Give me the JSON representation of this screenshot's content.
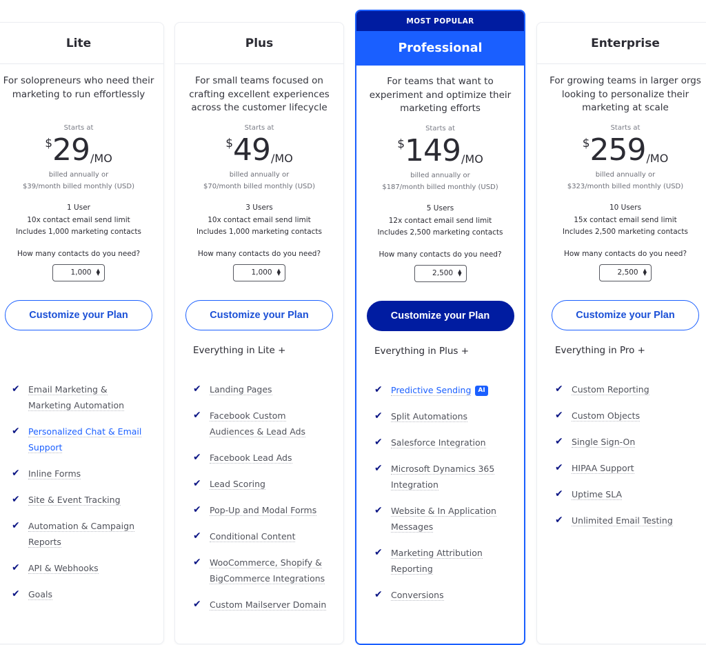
{
  "plans": [
    {
      "name": "Lite",
      "description": "For solopreneurs who need their marketing to run effortlessly",
      "starts_at": "Starts at",
      "currency": "$",
      "price": "29",
      "per": "/MO",
      "billed_line1": "billed annually or",
      "billed_line2": "$39/month billed monthly (USD)",
      "specs": [
        "1 User",
        "10x contact email send limit",
        "Includes 1,000 marketing contacts"
      ],
      "contacts_question": "How many contacts do you need?",
      "contacts_value": "1,000",
      "cta_label": "Customize your Plan",
      "everything_label": "",
      "features": [
        {
          "text": "Email Marketing & Marketing Automation",
          "link": false
        },
        {
          "text": "Personalized Chat & Email Support",
          "link": true
        },
        {
          "text": "Inline Forms",
          "link": false
        },
        {
          "text": "Site & Event Tracking",
          "link": false
        },
        {
          "text": "Automation & Campaign Reports",
          "link": false
        },
        {
          "text": "API & Webhooks",
          "link": false
        },
        {
          "text": "Goals",
          "link": false
        }
      ]
    },
    {
      "name": "Plus",
      "description": "For small teams focused on crafting excellent experiences across the customer lifecycle",
      "starts_at": "Starts at",
      "currency": "$",
      "price": "49",
      "per": "/MO",
      "billed_line1": "billed annually or",
      "billed_line2": "$70/month billed monthly (USD)",
      "specs": [
        "3 Users",
        "10x contact email send limit",
        "Includes 1,000 marketing contacts"
      ],
      "contacts_question": "How many contacts do you need?",
      "contacts_value": "1,000",
      "cta_label": "Customize your Plan",
      "everything_label": "Everything in Lite +",
      "features": [
        {
          "text": "Landing Pages",
          "link": false
        },
        {
          "text": "Facebook Custom Audiences & Lead Ads",
          "link": false
        },
        {
          "text": "Facebook Lead Ads",
          "link": false
        },
        {
          "text": "Lead Scoring",
          "link": false
        },
        {
          "text": "Pop-Up and Modal Forms",
          "link": false
        },
        {
          "text": "Conditional Content",
          "link": false
        },
        {
          "text": "WooCommerce, Shopify & BigCommerce Integrations",
          "link": false
        },
        {
          "text": "Custom Mailserver Domain",
          "link": false
        }
      ]
    },
    {
      "name": "Professional",
      "badge": "MOST POPULAR",
      "description": "For teams that want to experiment and optimize their marketing efforts",
      "starts_at": "Starts at",
      "currency": "$",
      "price": "149",
      "per": "/MO",
      "billed_line1": "billed annually or",
      "billed_line2": "$187/month billed monthly (USD)",
      "specs": [
        "5 Users",
        "12x contact email send limit",
        "Includes 2,500 marketing contacts"
      ],
      "contacts_question": "How many contacts do you need?",
      "contacts_value": "2,500",
      "cta_label": "Customize your Plan",
      "everything_label": "Everything in Plus +",
      "features": [
        {
          "text": "Predictive Sending",
          "link": true,
          "badge": "AI"
        },
        {
          "text": "Split Automations",
          "link": false
        },
        {
          "text": "Salesforce Integration",
          "link": false
        },
        {
          "text": "Microsoft Dynamics 365 Integration",
          "link": false
        },
        {
          "text": "Website & In Application Messages",
          "link": false
        },
        {
          "text": "Marketing Attribution Reporting",
          "link": false
        },
        {
          "text": "Conversions",
          "link": false
        }
      ]
    },
    {
      "name": "Enterprise",
      "description": "For growing teams in larger orgs looking to personalize their marketing at scale",
      "starts_at": "Starts at",
      "currency": "$",
      "price": "259",
      "per": "/MO",
      "billed_line1": "billed annually or",
      "billed_line2": "$323/month billed monthly (USD)",
      "specs": [
        "10 Users",
        "15x contact email send limit",
        "Includes 2,500 marketing contacts"
      ],
      "contacts_question": "How many contacts do you need?",
      "contacts_value": "2,500",
      "cta_label": "Customize your Plan",
      "everything_label": "Everything in Pro +",
      "features": [
        {
          "text": "Custom Reporting",
          "link": false
        },
        {
          "text": "Custom Objects",
          "link": false
        },
        {
          "text": "Single Sign-On",
          "link": false
        },
        {
          "text": "HIPAA Support",
          "link": false
        },
        {
          "text": "Uptime SLA",
          "link": false
        },
        {
          "text": "Unlimited Email Testing",
          "link": false
        }
      ]
    }
  ],
  "icons": {
    "check": "✔",
    "stepper_up": "▲",
    "stepper_down": "▼"
  },
  "colors": {
    "primary": "#1a5fff",
    "navy": "#001ca1",
    "check": "#0c1685"
  }
}
